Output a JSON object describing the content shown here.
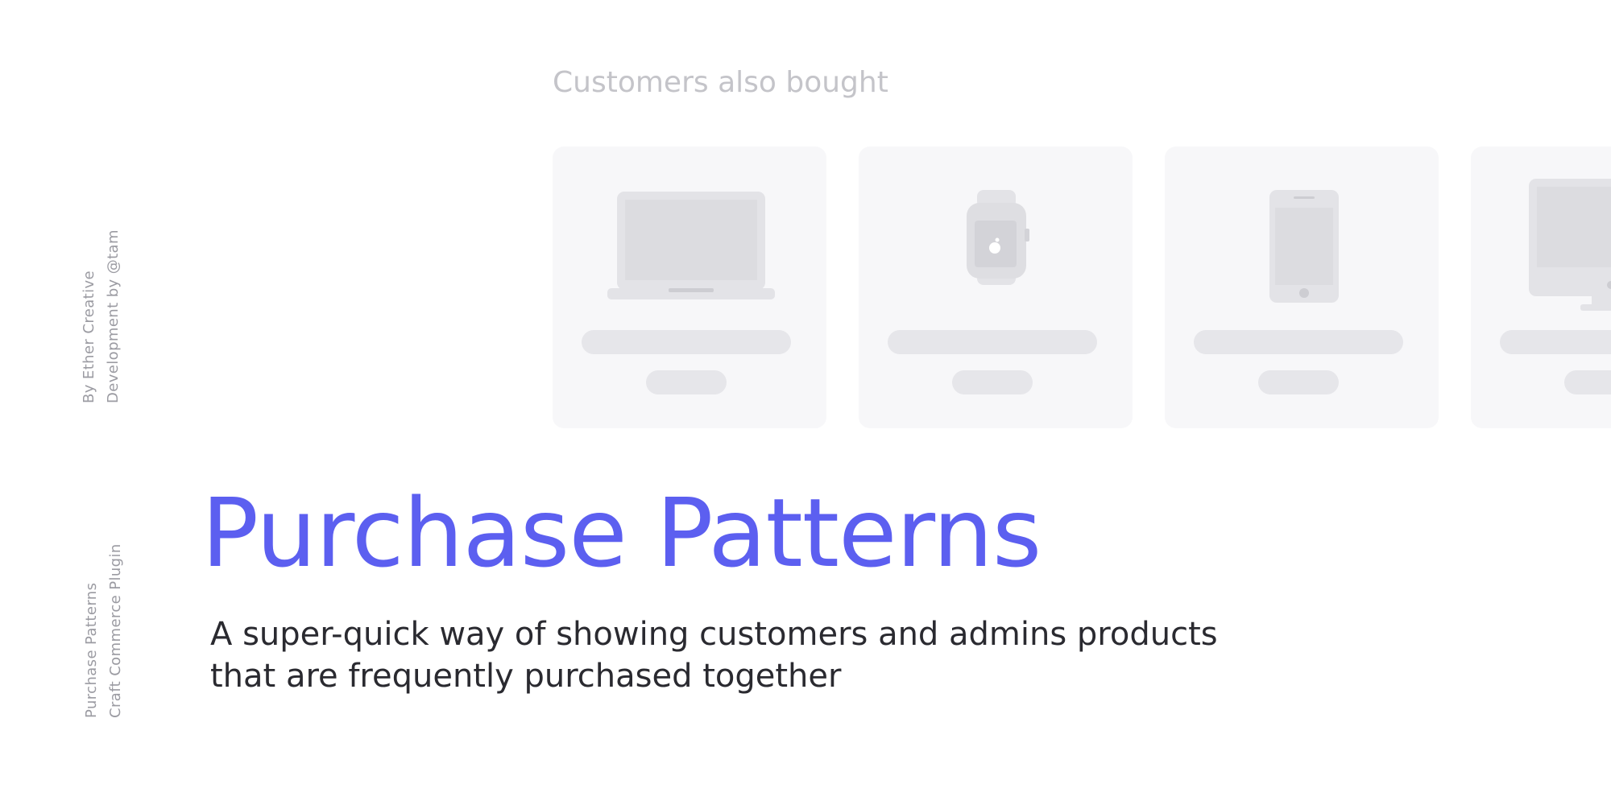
{
  "credits": {
    "line1": "By Ether Creative",
    "line2": "Development by @tam"
  },
  "plugin": {
    "line1": "Purchase Patterns",
    "line2": "Craft Commerce Plugin"
  },
  "section_heading": "Customers also bought",
  "products": [
    {
      "icon": "laptop-icon"
    },
    {
      "icon": "smartwatch-icon"
    },
    {
      "icon": "tablet-icon"
    },
    {
      "icon": "desktop-icon"
    }
  ],
  "title": "Purchase Patterns",
  "subtitle": {
    "line1": "A super-quick way of showing customers and admins products",
    "line2": "that are frequently purchased together"
  },
  "colors": {
    "accent": "#5c5ff0",
    "heading_muted": "#c4c4c9",
    "card_bg": "#f7f7f9",
    "placeholder": "#e6e6ea",
    "body_text": "#2a2a30"
  }
}
